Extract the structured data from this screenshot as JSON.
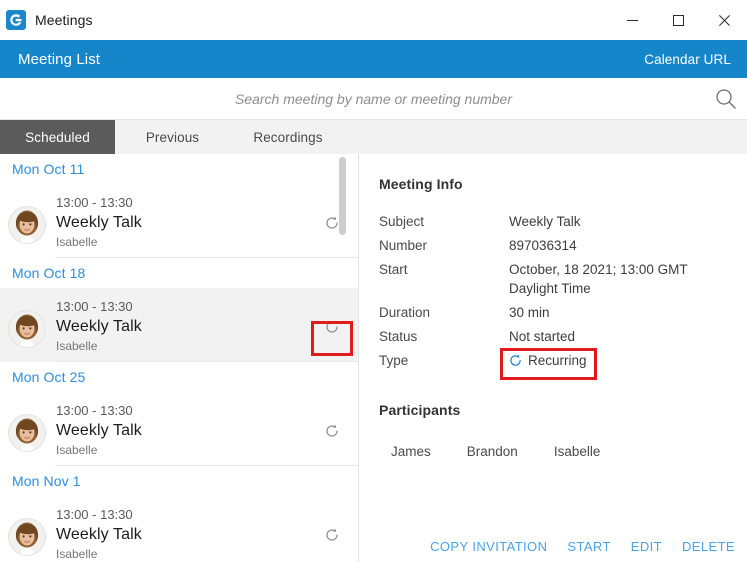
{
  "window": {
    "title": "Meetings",
    "app_icon": "gotomeeting-g-icon",
    "controls": [
      {
        "name": "minimize-button",
        "icon": "minimize-icon"
      },
      {
        "name": "maximize-button",
        "icon": "maximize-icon"
      },
      {
        "name": "close-button",
        "icon": "close-icon"
      }
    ]
  },
  "header": {
    "title": "Meeting List",
    "calendar_url_label": "Calendar URL",
    "accent_color": "#1686ca"
  },
  "search": {
    "placeholder": "Search meeting by name or meeting number",
    "value": "",
    "icon": "search-icon"
  },
  "tabs": [
    {
      "label": "Scheduled",
      "active": true
    },
    {
      "label": "Previous",
      "active": false
    },
    {
      "label": "Recordings",
      "active": false
    }
  ],
  "meeting_list": {
    "groups": [
      {
        "date": "Mon Oct 11",
        "meetings": [
          {
            "time": "13:00 - 13:30",
            "title": "Weekly Talk",
            "owner": "Isabelle",
            "recurring_icon": "recurring-icon",
            "selected": false
          }
        ]
      },
      {
        "date": "Mon Oct 18",
        "meetings": [
          {
            "time": "13:00 - 13:30",
            "title": "Weekly Talk",
            "owner": "Isabelle",
            "recurring_icon": "recurring-icon",
            "selected": true
          }
        ]
      },
      {
        "date": "Mon Oct 25",
        "meetings": [
          {
            "time": "13:00 - 13:30",
            "title": "Weekly Talk",
            "owner": "Isabelle",
            "recurring_icon": "recurring-icon",
            "selected": false
          }
        ]
      },
      {
        "date": "Mon Nov 1",
        "meetings": [
          {
            "time": "13:00 - 13:30",
            "title": "Weekly Talk",
            "owner": "Isabelle",
            "recurring_icon": "recurring-icon",
            "selected": false
          }
        ]
      }
    ]
  },
  "detail": {
    "meeting_info_title": "Meeting Info",
    "fields": [
      {
        "label": "Subject",
        "value": "Weekly Talk"
      },
      {
        "label": "Number",
        "value": "897036314"
      },
      {
        "label": "Start",
        "value": "October, 18 2021; 13:00 GMT Daylight Time"
      },
      {
        "label": "Duration",
        "value": "30 min"
      },
      {
        "label": "Status",
        "value": "Not started"
      },
      {
        "label": "Type",
        "value": "Recurring",
        "icon": "recurring-icon"
      }
    ],
    "participants_title": "Participants",
    "participants": [
      "James",
      "Brandon",
      "Isabelle"
    ],
    "actions": [
      {
        "label": "COPY INVITATION"
      },
      {
        "label": "START"
      },
      {
        "label": "EDIT"
      },
      {
        "label": "DELETE"
      }
    ],
    "action_color": "#4aa3e3"
  },
  "annotations": {
    "highlight_color": "#e01b1b",
    "boxes": [
      {
        "name": "recurring-icon-highlight"
      },
      {
        "name": "recurring-type-highlight"
      }
    ]
  }
}
